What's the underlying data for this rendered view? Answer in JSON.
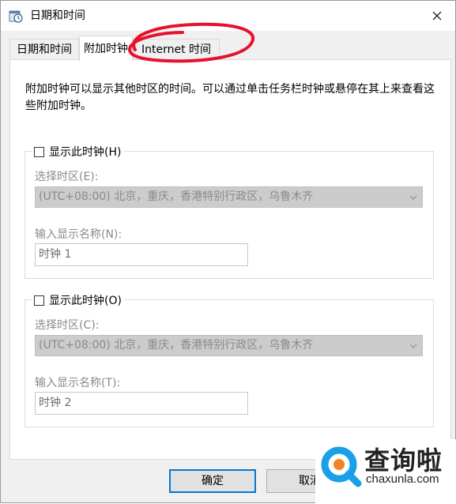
{
  "window": {
    "title": "日期和时间",
    "icon": "clock-calendar-icon",
    "close_icon": "close-icon"
  },
  "tabs": [
    {
      "label": "日期和时间",
      "selected": false
    },
    {
      "label": "附加时钟",
      "selected": true
    },
    {
      "label": "Internet 时间",
      "selected": false
    }
  ],
  "description": "附加时钟可以显示其他时区的时间。可以通过单击任务栏时钟或悬停在其上来查看这些附加时钟。",
  "clocks": [
    {
      "show_label": "显示此时钟(H)",
      "checked": false,
      "timezone_label": "选择时区(E):",
      "timezone_value": "(UTC+08:00) 北京，重庆，香港特别行政区，乌鲁木齐",
      "name_label": "输入显示名称(N):",
      "name_value": "时钟 1"
    },
    {
      "show_label": "显示此时钟(O)",
      "checked": false,
      "timezone_label": "选择时区(C):",
      "timezone_value": "(UTC+08:00) 北京，重庆，香港特别行政区，乌鲁木齐",
      "name_label": "输入显示名称(T):",
      "name_value": "时钟 2"
    }
  ],
  "buttons": {
    "ok": "确定",
    "cancel": "取消"
  },
  "watermark": {
    "name": "查询啦",
    "url": "chaxunla.com"
  },
  "colors": {
    "annotation": "#e8112d",
    "focus": "#0078d7",
    "logo_blue": "#1aa0e8",
    "logo_orange": "#f58220"
  }
}
